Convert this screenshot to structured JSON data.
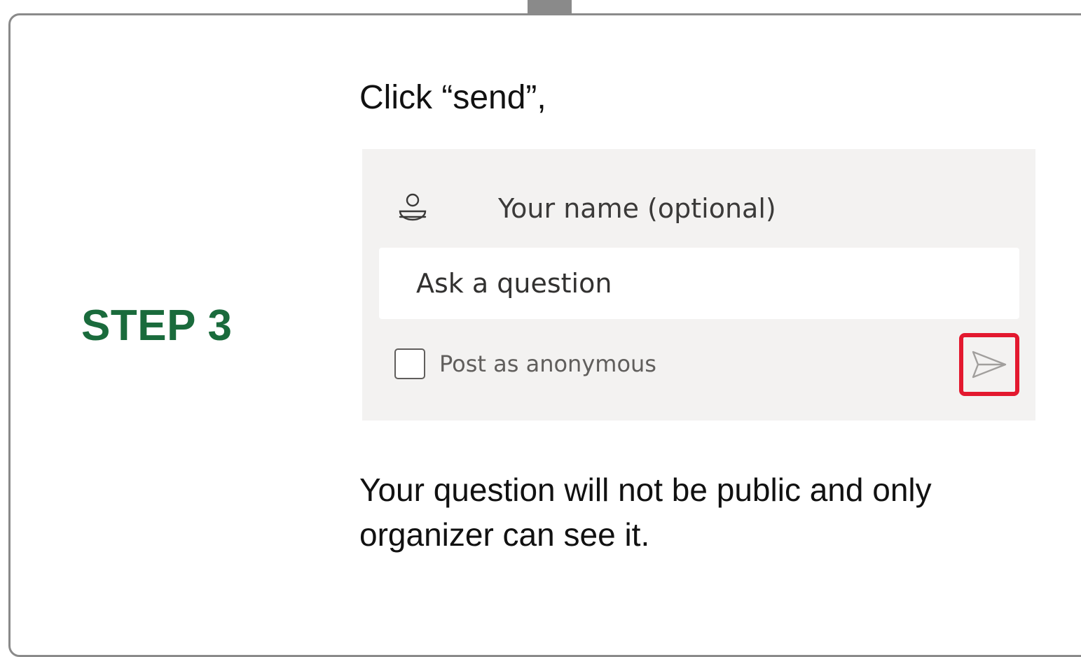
{
  "step": {
    "label": "STEP 3",
    "color": "#1a6b3c"
  },
  "instruction": "Click “send”,",
  "form": {
    "name_placeholder": "Your name (optional)",
    "name_icon": "person-icon",
    "question_placeholder": "Ask a question",
    "anonymous_label": "Post as anonymous",
    "anonymous_checked": false,
    "send_icon": "send-icon",
    "highlight_color": "#e3192f"
  },
  "note": "Your question will not be public and only organizer can see it."
}
